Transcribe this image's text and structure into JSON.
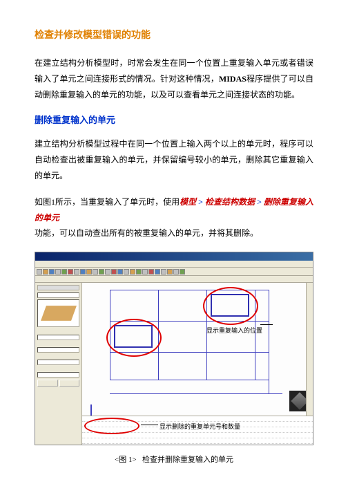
{
  "title_main": "检查并修改模型错误的功能",
  "paragraph1": "在建立结构分析模型时，时常会发生在同一个位置上重复输入单元或者错误输入了单元之间连接形式的情况。针对这种情况，",
  "paragraph1_bold": "MIDAS",
  "paragraph1_cont": "程序提供了可以自动删除重复输入的单元的功能，以及可以查看单元之间连接状态的功能。",
  "subtitle1": "删除重复输入的单元",
  "paragraph2": "建立结构分析模型过程中在同一个位置上输入两个以上的单元时，程序可以自动检查出被重复输入的单元，并保留编号较小的单元，删除其它重复输入的单元。",
  "paragraph3_a": "如图1所示，当重复输入了单元时，使用",
  "menu_path1": "模型",
  "arrow": " > ",
  "menu_path2": "检查结构数据",
  "menu_path3": "删除重复输入的单元",
  "paragraph3_b": "功能，可以自动查出所有的被重复输入的单元，并将其删除。",
  "figure": {
    "callout1": "显示重复输入的位置",
    "callout2": "显示删除的重复单元号和数量",
    "caption_prefix": "<图 1>",
    "caption": "检查并删除重复输入的单元"
  }
}
